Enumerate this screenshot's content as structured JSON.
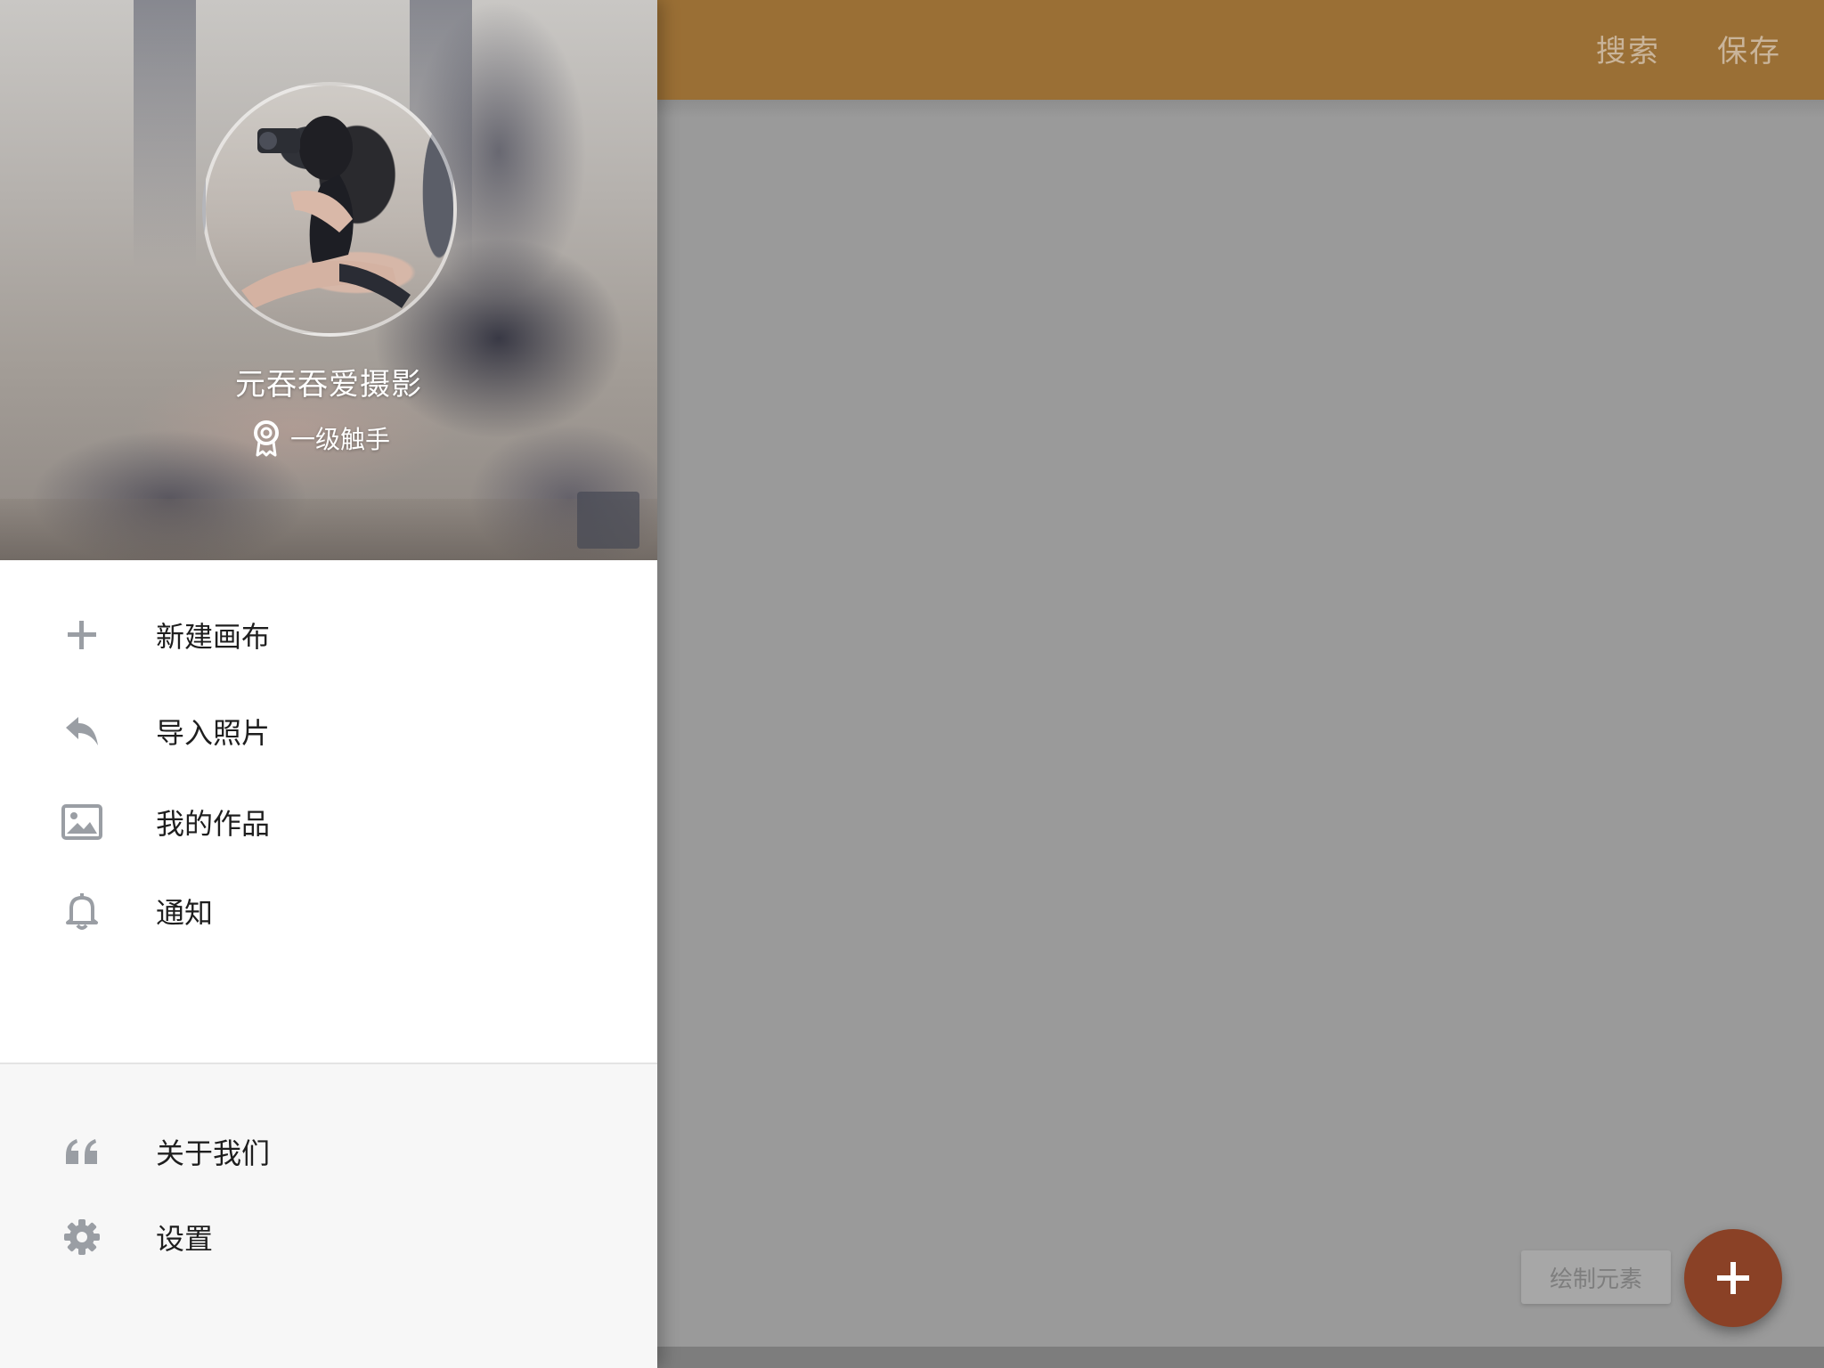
{
  "app": {
    "appbar_color": "#9a6f35",
    "actions": {
      "search_label": "搜索",
      "save_label": "保存"
    },
    "draw_chip_label": "绘制元素",
    "fab_color": "#8a4126",
    "fab_icon": "plus-icon"
  },
  "drawer": {
    "user": {
      "name": "元吞吞爱摄影",
      "level": "一级触手",
      "level_icon": "badge-icon"
    },
    "menu": [
      {
        "label": "新建画布",
        "icon": "plus-icon"
      },
      {
        "label": "导入照片",
        "icon": "reply-icon"
      },
      {
        "label": "我的作品",
        "icon": "image-icon"
      },
      {
        "label": "通知",
        "icon": "bell-icon"
      }
    ],
    "footer": [
      {
        "label": "关于我们",
        "icon": "quote-icon"
      },
      {
        "label": "设置",
        "icon": "gear-icon"
      }
    ]
  }
}
